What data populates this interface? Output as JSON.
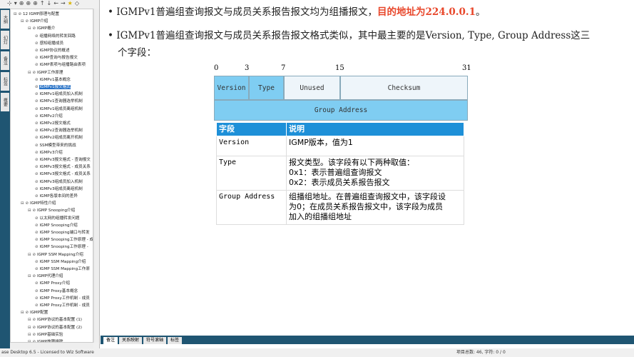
{
  "toolbar": {
    "icons": [
      "tree-icon",
      "dropdown-icon",
      "node-icon",
      "node2-icon",
      "node3-icon",
      "up-icon",
      "down-icon",
      "left-icon",
      "right-icon",
      "star-icon",
      "tag-icon"
    ]
  },
  "vtabs": [
    "大纲",
    "幻灯",
    "备注",
    "标签",
    "概要"
  ],
  "tree": [
    {
      "t": "12 IGMP原理与配置",
      "l": 0
    },
    {
      "t": "IGMP介绍",
      "l": 1
    },
    {
      "t": "IGMP概介",
      "l": 2
    },
    {
      "t": "组播网络的转发回路",
      "l": 3
    },
    {
      "t": "感知组播成员",
      "l": 3
    },
    {
      "t": "IGMP协议的概述",
      "l": 3
    },
    {
      "t": "IGMP查询与报告报文",
      "l": 3
    },
    {
      "t": "IGMP表项与组播路由表项",
      "l": 3
    },
    {
      "t": "IGMP工作原理",
      "l": 2
    },
    {
      "t": "IGMPv1基本概念",
      "l": 3
    },
    {
      "t": "IGMPv1报文格式",
      "l": 3,
      "sel": true
    },
    {
      "t": "IGMPv1组成员加入机制",
      "l": 3
    },
    {
      "t": "IGMPv1查询器选举机制",
      "l": 3
    },
    {
      "t": "IGMPv1组成员离组机制",
      "l": 3
    },
    {
      "t": "IGMPv2介绍",
      "l": 3
    },
    {
      "t": "IGMPv2报文格式",
      "l": 3
    },
    {
      "t": "IGMPv2查询器选举机制",
      "l": 3
    },
    {
      "t": "IGMPv2组成员离开机制",
      "l": 3
    },
    {
      "t": "SSM模型带来的挑战",
      "l": 3
    },
    {
      "t": "IGMPv3介绍",
      "l": 3
    },
    {
      "t": "IGMPv3报文格式 - 查询报文",
      "l": 3
    },
    {
      "t": "IGMPv3报文格式 - 成员关系",
      "l": 3
    },
    {
      "t": "IGMPv3报文格式 - 成员关系",
      "l": 3
    },
    {
      "t": "IGMPv3组成员加入机制",
      "l": 3
    },
    {
      "t": "IGMPv3组成员离组机制",
      "l": 3
    },
    {
      "t": "IGMP各版本间的差异",
      "l": 3
    },
    {
      "t": "IGMP特性介绍",
      "l": 1
    },
    {
      "t": "IGMP Snooping介绍",
      "l": 2
    },
    {
      "t": "以太网的组播转发问题",
      "l": 3
    },
    {
      "t": "IGMP Snooping介绍",
      "l": 3
    },
    {
      "t": "IGMP Snooping端口与转发",
      "l": 3
    },
    {
      "t": "IGMP Snooping工作原理 - 成",
      "l": 3
    },
    {
      "t": "IGMP Snooping工作原理 -",
      "l": 3
    },
    {
      "t": "IGMP SSM Mapping介绍",
      "l": 2
    },
    {
      "t": "IGMP SSM Mapping介绍",
      "l": 3
    },
    {
      "t": "IGMP SSM Mapping工作原",
      "l": 3
    },
    {
      "t": "IGMP代理介绍",
      "l": 2
    },
    {
      "t": "IGMP Proxy介绍",
      "l": 3
    },
    {
      "t": "IGMP Proxy基本概念",
      "l": 3
    },
    {
      "t": "IGMP Proxy工作机制 - 成员",
      "l": 3
    },
    {
      "t": "IGMP Proxy工作机制 - 成员",
      "l": 3
    },
    {
      "t": "IGMP配置",
      "l": 1
    },
    {
      "t": "IGMP协议的基本配置 (1)",
      "l": 2
    },
    {
      "t": "IGMP协议的基本配置 (2)",
      "l": 2
    },
    {
      "t": "IGMP基础实验",
      "l": 2
    },
    {
      "t": "IGMP故障排除",
      "l": 2
    }
  ],
  "main": {
    "b1_pre": "IGMPv1普遍组查询报文与成员关系报告报文均为组播报文，",
    "b1_red": "目的地址为224.0.0.1",
    "b1_post": "。",
    "b2_l1": "IGMPv1普遍组查询报文与成员关系报告报文格式类似，其中最主要的是Version, Type, Group Address这三",
    "b2_l2": "个字段：",
    "bits": [
      "0",
      "3",
      "7",
      "15",
      "31"
    ],
    "fields": {
      "version": "Version",
      "type": "Type",
      "unused": "Unused",
      "checksum": "Checksum",
      "group": "Group Address"
    },
    "table": {
      "h1": "字段",
      "h2": "说明",
      "rows": [
        {
          "f": "Version",
          "d": [
            "IGMP版本，值为1"
          ]
        },
        {
          "f": "Type",
          "d": [
            "报文类型。该字段有以下两种取值：",
            "0x1：表示普遍组查询报文",
            "0x2：表示成员关系报告报文"
          ]
        },
        {
          "f": "Group Address",
          "d": [
            "组播组地址。在普遍组查询报文中，该字段设",
            "为0；在成员关系报告报文中，该字段为成员",
            "加入的组播组地址"
          ]
        }
      ]
    }
  },
  "bottom_tabs": [
    "备注",
    "关系映射",
    "符号滚轴",
    "标签"
  ],
  "status": {
    "left": "ase Desktop 6.5 - Licensed to Wiz Software",
    "right": "项目总数: 46, 字符: 0 / 0"
  },
  "colors": {
    "accent": "#1e90d8",
    "red": "#e8462a",
    "cell": "#7fcdf2"
  }
}
